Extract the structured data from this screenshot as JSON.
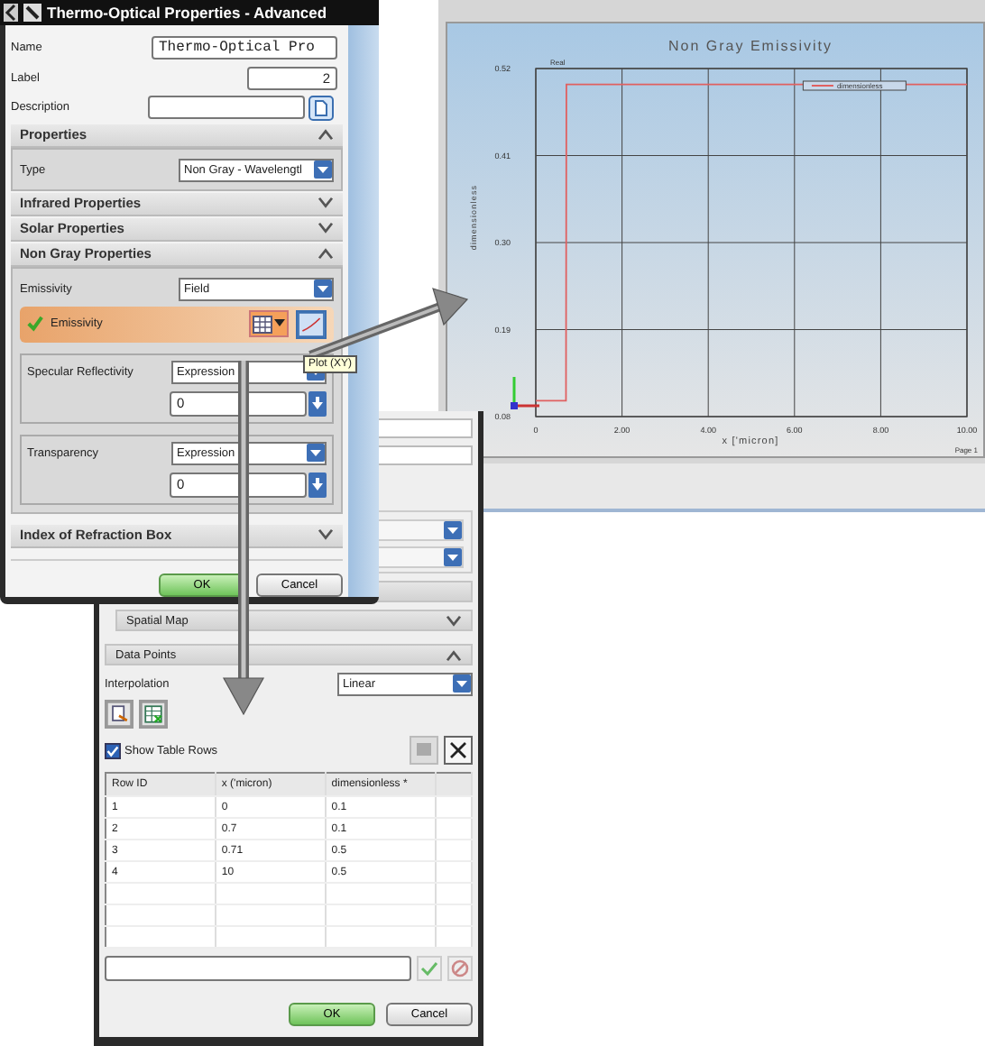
{
  "main_dialog": {
    "title": "Thermo-Optical Properties - Advanced",
    "fields": [
      {
        "kind": "text",
        "label": "Name",
        "value": "Thermo-Optical Pro"
      },
      {
        "kind": "number",
        "label": "Label",
        "value": "2"
      },
      {
        "kind": "file",
        "label": "Description"
      }
    ],
    "sections": [
      {
        "title": "Properties",
        "expanded": true,
        "rows": [
          {
            "kind": "dropdown",
            "label": "Type",
            "value": "Non Gray - Wavelengtl"
          }
        ]
      },
      {
        "title": "Infrared Properties",
        "expanded": false
      },
      {
        "title": "Solar Properties",
        "expanded": false
      },
      {
        "title": "Non Gray Properties",
        "expanded": true,
        "rows": [
          {
            "kind": "dropdown",
            "label": "Emissivity",
            "value": "Field"
          },
          {
            "kind": "field_picker",
            "label": "Emissivity",
            "valid": true
          },
          {
            "kind": "expression",
            "label": "Specular Reflectivity",
            "value": "Expression",
            "amount": "0"
          },
          {
            "kind": "expression",
            "label": "Transparency",
            "value": "Expression",
            "amount": "0"
          }
        ]
      },
      {
        "title": "Index of Refraction Box",
        "expanded": false
      }
    ],
    "buttons": [
      {
        "label": "OK",
        "default": true
      },
      {
        "label": "Cancel",
        "default": false
      }
    ]
  },
  "tooltip": "Plot (XY)",
  "chart_window": {
    "corner_label": "Real",
    "page_label": "Page 1",
    "chart_data": {
      "type": "line",
      "title": "Non Gray Emissivity",
      "xlabel": "x ['micron]",
      "ylabel": "dimensionless",
      "x": [
        0,
        0.7,
        0.71,
        10
      ],
      "series": [
        {
          "name": "dimensionless",
          "color": "#e06060",
          "values": [
            0.1,
            0.1,
            0.5,
            0.5
          ]
        }
      ],
      "grid": true,
      "xlim": [
        0,
        10
      ],
      "ylim": [
        0.08,
        0.52
      ],
      "xticks": [
        {
          "value": 0,
          "label": "0"
        },
        {
          "value": 2,
          "label": "2.00"
        },
        {
          "value": 4,
          "label": "4.00"
        },
        {
          "value": 6,
          "label": "6.00"
        },
        {
          "value": 8,
          "label": "8.00"
        },
        {
          "value": 10,
          "label": "10.00"
        }
      ],
      "yticks": [
        {
          "value": 0.08,
          "label": "0.08"
        },
        {
          "value": 0.19,
          "label": "0.19"
        },
        {
          "value": 0.3,
          "label": "0.30"
        },
        {
          "value": 0.41,
          "label": "0.41"
        },
        {
          "value": 0.52,
          "label": "0.52"
        }
      ]
    }
  },
  "table_dialog": {
    "sections": [
      {
        "title": "Spatial Map",
        "expanded": false
      },
      {
        "title": "Data Points",
        "expanded": true
      }
    ],
    "interpolation": {
      "label": "Interpolation",
      "value": "Linear"
    },
    "show_table_rows": {
      "label": "Show Table Rows",
      "checked": true
    },
    "table": {
      "columns": [
        "Row ID",
        "x ('micron)",
        "dimensionless *"
      ],
      "rows": [
        [
          "1",
          "0",
          "0.1"
        ],
        [
          "2",
          "0.7",
          "0.1"
        ],
        [
          "3",
          "0.71",
          "0.5"
        ],
        [
          "4",
          "10",
          "0.5"
        ]
      ]
    },
    "buttons": [
      {
        "label": "OK",
        "default": true
      },
      {
        "label": "Cancel",
        "default": false
      }
    ]
  }
}
